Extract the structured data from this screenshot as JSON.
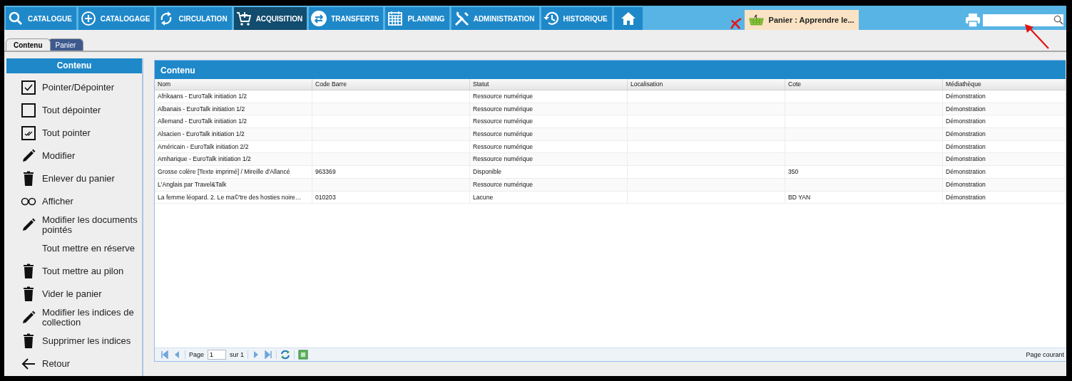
{
  "nav": {
    "items": [
      {
        "label": "CATALOGUE",
        "selected": false
      },
      {
        "label": "CATALOGAGE",
        "selected": false
      },
      {
        "label": "CIRCULATION",
        "selected": false
      },
      {
        "label": "ACQUISITION",
        "selected": true
      },
      {
        "label": "TRANSFERTS",
        "selected": false
      },
      {
        "label": "PLANNING",
        "selected": false
      },
      {
        "label": "ADMINISTRATION",
        "selected": false
      },
      {
        "label": "HISTORIQUE",
        "selected": false
      },
      {
        "selected": false
      }
    ]
  },
  "basket_tab": {
    "title": "Panier : Apprendre le..."
  },
  "subtabs": [
    {
      "label": "Contenu",
      "selected": true
    },
    {
      "label": "Panier",
      "selected": false
    }
  ],
  "sidebar": {
    "title": "Contenu",
    "items": [
      "Pointer/Dépointer",
      "Tout dépointer",
      "Tout pointer",
      "Modifier",
      "Enlever du panier",
      "Afficher",
      "Modifier les documents pointés",
      "Tout mettre en réserve",
      "Tout mettre au pilon",
      "Vider le panier",
      "Modifier les indices de collection",
      "Supprimer les indices",
      "Retour"
    ]
  },
  "grid": {
    "title": "Contenu",
    "columns": [
      "Nom",
      "Code Barre",
      "Statut",
      "Localisation",
      "Cote",
      "Médiathèque"
    ],
    "rows": [
      [
        "Afrikaans - EuroTalk initiation 1/2",
        null,
        "Ressource numérique",
        null,
        null,
        "Démonstration"
      ],
      [
        "Albanais - EuroTalk initiation 1/2",
        null,
        "Ressource numérique",
        null,
        null,
        "Démonstration"
      ],
      [
        "Allemand - EuroTalk initiation 1/2",
        null,
        "Ressource numérique",
        null,
        null,
        "Démonstration"
      ],
      [
        "Alsacien - EuroTalk initiation 1/2",
        null,
        "Ressource numérique",
        null,
        null,
        "Démonstration"
      ],
      [
        "Américain - EuroTalk initiation 2/2",
        null,
        "Ressource numérique",
        null,
        null,
        "Démonstration"
      ],
      [
        "Amharique - EuroTalk initiation 1/2",
        null,
        "Ressource numérique",
        null,
        null,
        "Démonstration"
      ],
      [
        "Grosse colère [Texte imprimé] / Mireille d'Allancé",
        "963369",
        "Disponible",
        null,
        "350",
        "Démonstration"
      ],
      [
        "L'Anglais par Travel&Talk",
        null,
        "Ressource numérique",
        null,
        null,
        "Démonstration"
      ],
      [
        "La femme léopard. 2. Le ma©'tre des hosties noire…",
        "010203",
        "Lacune",
        null,
        "BD YAN",
        "Démonstration"
      ]
    ]
  },
  "pager": {
    "page_label": "Page",
    "page": "1",
    "of_label": "sur 1",
    "status": "Page courant"
  }
}
